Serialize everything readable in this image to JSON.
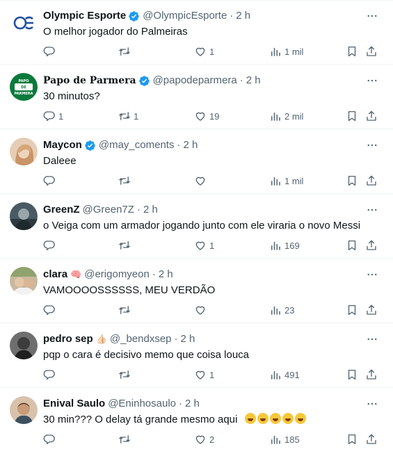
{
  "tweets": [
    {
      "name": "Olympic Esporte",
      "verified": true,
      "handle": "@OlympicEsporte",
      "dot": "·",
      "time": "2 h",
      "text": "O melhor jogador do Palmeiras",
      "replies": "",
      "retweets": "",
      "likes": "1",
      "views": "1 mil",
      "avatar": {
        "bg": "#ffffff",
        "fg": "#1f4fa0",
        "label": "oe"
      }
    },
    {
      "name": "Papo de Parmera",
      "verified": true,
      "handle": "@papodeparmera",
      "dot": "·",
      "time": "2 h",
      "text": "30 minutos?",
      "replies": "1",
      "retweets": "1",
      "likes": "19",
      "views": "2 mil",
      "avatar": {
        "bg": "#0a7a3c",
        "fg": "#ffffff",
        "label": "PAPO DE PARMERA"
      }
    },
    {
      "name": "Maycon",
      "verified": true,
      "handle": "@may_coments",
      "dot": "·",
      "time": "2 h",
      "text": "Daleee",
      "replies": "",
      "retweets": "",
      "likes": "",
      "views": "1 mil",
      "avatar": {
        "bg": "#d9b79b",
        "fg": "#6b4a36",
        "label": ""
      }
    },
    {
      "name": "GreenZ",
      "verified": false,
      "handle": "@Green7Z",
      "dot": "·",
      "time": "2 h",
      "text": "o Veiga com um armador jogando junto com ele viraria o novo Messi",
      "replies": "",
      "retweets": "",
      "likes": "1",
      "views": "169",
      "avatar": {
        "bg": "#3a4a52",
        "fg": "#c9d1d6",
        "label": ""
      }
    },
    {
      "name": "clara",
      "verified": false,
      "emoji": "🧠",
      "handle": "@erigomyeon",
      "dot": "·",
      "time": "2 h",
      "text": "VAMOOOOSSSSSS, MEU VERDÃO",
      "replies": "",
      "retweets": "",
      "likes": "",
      "views": "23",
      "avatar": {
        "bg": "#b7a58c",
        "fg": "#4e5f3a",
        "label": ""
      }
    },
    {
      "name": "pedro sep",
      "verified": false,
      "emoji": "👍🏻",
      "handle": "@_bendxsep",
      "dot": "·",
      "time": "2 h",
      "text": "pqp o cara é decisivo memo que coisa louca",
      "replies": "",
      "retweets": "",
      "likes": "1",
      "views": "491",
      "avatar": {
        "bg": "#5c5c5c",
        "fg": "#2a2a2a",
        "label": ""
      }
    },
    {
      "name": "Enival Saulo",
      "verified": false,
      "handle": "@Eninhosaulo",
      "dot": "·",
      "time": "2 h",
      "text": "30 min??? O delay tá grande mesmo aqui",
      "replies": "",
      "retweets": "",
      "likes": "2",
      "views": "185",
      "avatar": {
        "bg": "#c9a58a",
        "fg": "#3e2a20",
        "label": ""
      }
    }
  ],
  "icons": {
    "more": "more-icon",
    "reply": "reply-icon",
    "retweet": "retweet-icon",
    "like": "heart-icon",
    "views": "views-icon",
    "bookmark": "bookmark-icon",
    "share": "share-icon",
    "verified": "verified-badge-icon"
  },
  "colors": {
    "text": "#0f1419",
    "secondary": "#536471",
    "verified": "#1d9bf0",
    "border": "#eff3f4"
  }
}
